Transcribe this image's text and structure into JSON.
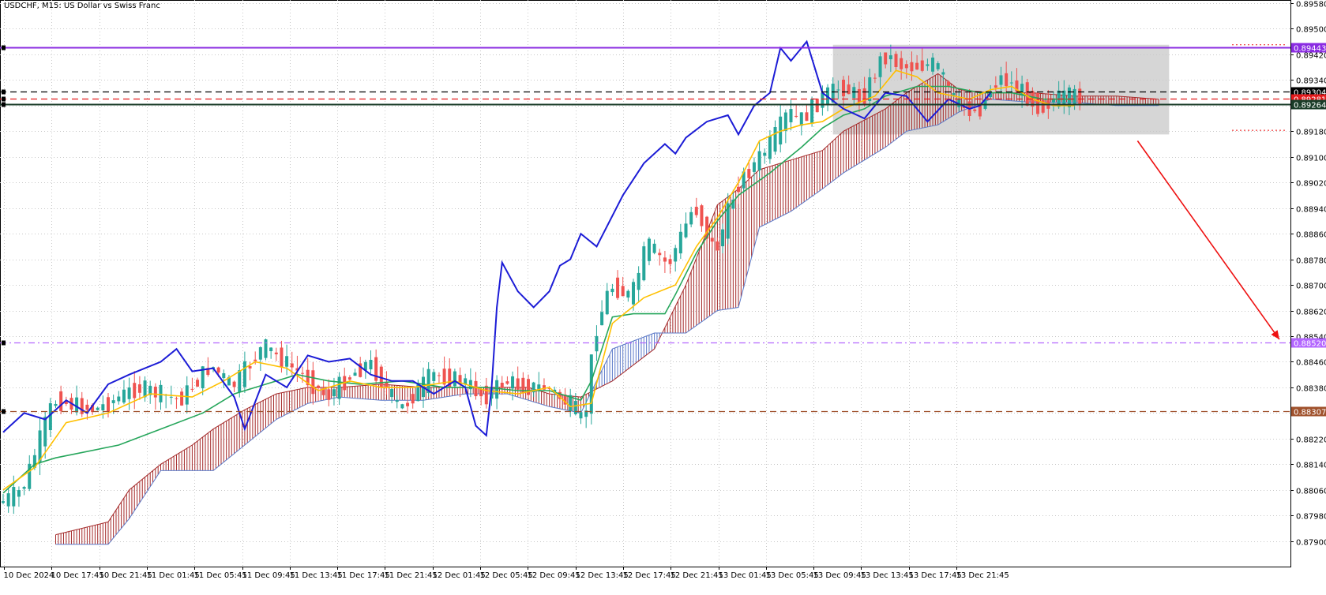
{
  "title": "USDCHF, M15:  US Dollar vs Swiss Franc",
  "colors": {
    "background": "#ffffff",
    "grid": "#c8c8c8",
    "bull": "#26a69a",
    "bear": "#ef5350",
    "tenkan": "#ffc000",
    "kijun": "#26a65b",
    "chikou": "#1c1cd6",
    "cloud_bull": "#5b79c8",
    "cloud_bear": "#a52a2a",
    "resistance": "#8a2be2",
    "tgt": "#b366ff",
    "support": "#a0522d",
    "arrow": "#ee1111",
    "zone": "#c8c8c8"
  },
  "chart_data": {
    "type": "candlestick",
    "symbol": "USDCHF",
    "timeframe": "M15",
    "ylim": [
      0.8785,
      0.8958
    ],
    "y_ticks": [
      "0.89580",
      "0.89500",
      "0.89420",
      "0.89340",
      "0.89260",
      "0.89180",
      "0.89100",
      "0.89020",
      "0.88940",
      "0.88860",
      "0.88780",
      "0.88700",
      "0.88620",
      "0.88540",
      "0.88460",
      "0.88380",
      "0.88300",
      "0.88220",
      "0.88140",
      "0.88060",
      "0.87980",
      "0.87900"
    ],
    "x_ticks": [
      "10 Dec 2024",
      "10 Dec 17:45",
      "10 Dec 21:45",
      "11 Dec 01:45",
      "11 Dec 05:45",
      "11 Dec 09:45",
      "11 Dec 13:45",
      "11 Dec 17:45",
      "11 Dec 21:45",
      "12 Dec 01:45",
      "12 Dec 05:45",
      "12 Dec 09:45",
      "12 Dec 13:45",
      "12 Dec 17:45",
      "12 Dec 21:45",
      "13 Dec 01:45",
      "13 Dec 05:45",
      "13 Dec 09:45",
      "13 Dec 13:45",
      "13 Dec 17:45",
      "13 Dec 21:45"
    ],
    "price_path": [
      [
        0,
        0.8802
      ],
      [
        4,
        0.8806
      ],
      [
        10,
        0.8834
      ],
      [
        18,
        0.8831
      ],
      [
        26,
        0.8838
      ],
      [
        34,
        0.8834
      ],
      [
        40,
        0.8845
      ],
      [
        44,
        0.8838
      ],
      [
        50,
        0.8851
      ],
      [
        58,
        0.8841
      ],
      [
        62,
        0.8835
      ],
      [
        66,
        0.8841
      ],
      [
        70,
        0.8846
      ],
      [
        76,
        0.8831
      ],
      [
        82,
        0.8842
      ],
      [
        88,
        0.884
      ],
      [
        92,
        0.8835
      ],
      [
        96,
        0.884
      ],
      [
        100,
        0.8838
      ],
      [
        104,
        0.8838
      ],
      [
        107,
        0.8834
      ],
      [
        109,
        0.8832
      ],
      [
        111,
        0.8826
      ],
      [
        113,
        0.8855
      ],
      [
        116,
        0.887
      ],
      [
        120,
        0.8866
      ],
      [
        123,
        0.8883
      ],
      [
        127,
        0.8876
      ],
      [
        132,
        0.8895
      ],
      [
        136,
        0.888
      ],
      [
        140,
        0.8901
      ],
      [
        146,
        0.8913
      ],
      [
        150,
        0.8924
      ],
      [
        152,
        0.8921
      ],
      [
        156,
        0.8928
      ],
      [
        160,
        0.8932
      ],
      [
        164,
        0.8928
      ],
      [
        168,
        0.8942
      ],
      [
        172,
        0.8938
      ],
      [
        178,
        0.8939
      ],
      [
        182,
        0.8926
      ],
      [
        186,
        0.8924
      ],
      [
        190,
        0.8935
      ],
      [
        194,
        0.8931
      ],
      [
        198,
        0.8925
      ],
      [
        200,
        0.8928
      ],
      [
        205,
        0.8929
      ]
    ],
    "tenkan_path": [
      [
        0,
        0.8806
      ],
      [
        6,
        0.8813
      ],
      [
        12,
        0.8827
      ],
      [
        20,
        0.883
      ],
      [
        28,
        0.8836
      ],
      [
        36,
        0.8835
      ],
      [
        42,
        0.884
      ],
      [
        48,
        0.8846
      ],
      [
        54,
        0.8844
      ],
      [
        60,
        0.8837
      ],
      [
        66,
        0.884
      ],
      [
        72,
        0.8838
      ],
      [
        78,
        0.8838
      ],
      [
        86,
        0.884
      ],
      [
        92,
        0.8837
      ],
      [
        98,
        0.8836
      ],
      [
        104,
        0.8838
      ],
      [
        108,
        0.8832
      ],
      [
        112,
        0.8833
      ],
      [
        116,
        0.8858
      ],
      [
        122,
        0.8866
      ],
      [
        128,
        0.887
      ],
      [
        132,
        0.8882
      ],
      [
        136,
        0.8891
      ],
      [
        140,
        0.8902
      ],
      [
        144,
        0.8915
      ],
      [
        148,
        0.8918
      ],
      [
        152,
        0.892
      ],
      [
        156,
        0.8921
      ],
      [
        160,
        0.8925
      ],
      [
        166,
        0.8929
      ],
      [
        170,
        0.8937
      ],
      [
        174,
        0.8935
      ],
      [
        178,
        0.893
      ],
      [
        184,
        0.8928
      ],
      [
        188,
        0.8931
      ],
      [
        192,
        0.8932
      ],
      [
        196,
        0.8928
      ],
      [
        200,
        0.8926
      ],
      [
        204,
        0.8926
      ]
    ],
    "kijun_path": [
      [
        0,
        0.8805
      ],
      [
        6,
        0.8814
      ],
      [
        10,
        0.8816
      ],
      [
        22,
        0.882
      ],
      [
        30,
        0.8825
      ],
      [
        38,
        0.883
      ],
      [
        44,
        0.8836
      ],
      [
        50,
        0.8839
      ],
      [
        56,
        0.8842
      ],
      [
        62,
        0.884
      ],
      [
        68,
        0.8839
      ],
      [
        76,
        0.884
      ],
      [
        84,
        0.8838
      ],
      [
        92,
        0.8838
      ],
      [
        98,
        0.8837
      ],
      [
        104,
        0.8837
      ],
      [
        110,
        0.8834
      ],
      [
        112,
        0.884
      ],
      [
        116,
        0.886
      ],
      [
        120,
        0.8861
      ],
      [
        126,
        0.8861
      ],
      [
        128,
        0.8867
      ],
      [
        132,
        0.888
      ],
      [
        136,
        0.889
      ],
      [
        140,
        0.8898
      ],
      [
        146,
        0.8905
      ],
      [
        152,
        0.8913
      ],
      [
        156,
        0.8919
      ],
      [
        160,
        0.8923
      ],
      [
        164,
        0.8925
      ],
      [
        168,
        0.8929
      ],
      [
        174,
        0.8932
      ],
      [
        180,
        0.8932
      ],
      [
        186,
        0.893
      ],
      [
        192,
        0.893
      ],
      [
        198,
        0.8928
      ],
      [
        204,
        0.8928
      ]
    ],
    "chikou_path": [
      [
        0,
        0.8824
      ],
      [
        4,
        0.883
      ],
      [
        8,
        0.8828
      ],
      [
        12,
        0.8834
      ],
      [
        16,
        0.883
      ],
      [
        20,
        0.8839
      ],
      [
        24,
        0.8842
      ],
      [
        30,
        0.8846
      ],
      [
        33,
        0.885
      ],
      [
        36,
        0.8843
      ],
      [
        40,
        0.8844
      ],
      [
        44,
        0.8835
      ],
      [
        46,
        0.8825
      ],
      [
        50,
        0.8842
      ],
      [
        54,
        0.8838
      ],
      [
        58,
        0.8848
      ],
      [
        62,
        0.8846
      ],
      [
        66,
        0.8847
      ],
      [
        70,
        0.8842
      ],
      [
        74,
        0.884
      ],
      [
        78,
        0.884
      ],
      [
        82,
        0.8836
      ],
      [
        86,
        0.884
      ],
      [
        88,
        0.8838
      ],
      [
        90,
        0.8826
      ],
      [
        92,
        0.8823
      ],
      [
        93,
        0.8838
      ],
      [
        94,
        0.8863
      ],
      [
        95,
        0.8877
      ],
      [
        98,
        0.8868
      ],
      [
        101,
        0.8863
      ],
      [
        104,
        0.8868
      ],
      [
        106,
        0.8876
      ],
      [
        108,
        0.8878
      ],
      [
        110,
        0.8886
      ],
      [
        113,
        0.8882
      ],
      [
        118,
        0.8898
      ],
      [
        122,
        0.8908
      ],
      [
        126,
        0.8914
      ],
      [
        128,
        0.8911
      ],
      [
        130,
        0.8916
      ],
      [
        134,
        0.8921
      ],
      [
        138,
        0.8923
      ],
      [
        140,
        0.8917
      ],
      [
        143,
        0.8926
      ],
      [
        146,
        0.893
      ],
      [
        148,
        0.8944
      ],
      [
        150,
        0.894
      ],
      [
        153,
        0.8946
      ],
      [
        156,
        0.893
      ],
      [
        160,
        0.8925
      ],
      [
        164,
        0.8922
      ],
      [
        168,
        0.893
      ],
      [
        172,
        0.8929
      ],
      [
        176,
        0.8921
      ],
      [
        180,
        0.8928
      ],
      [
        184,
        0.8925
      ],
      [
        186,
        0.8926
      ],
      [
        188,
        0.893
      ]
    ],
    "cloud_a": [
      [
        10,
        0.8792
      ],
      [
        20,
        0.8796
      ],
      [
        24,
        0.8806
      ],
      [
        30,
        0.8814
      ],
      [
        36,
        0.882
      ],
      [
        40,
        0.8825
      ],
      [
        46,
        0.8831
      ],
      [
        52,
        0.8836
      ],
      [
        58,
        0.8838
      ],
      [
        64,
        0.8838
      ],
      [
        72,
        0.8839
      ],
      [
        80,
        0.8838
      ],
      [
        88,
        0.8838
      ],
      [
        96,
        0.8838
      ],
      [
        100,
        0.8838
      ],
      [
        104,
        0.8836
      ],
      [
        110,
        0.8835
      ],
      [
        116,
        0.884
      ],
      [
        124,
        0.885
      ],
      [
        130,
        0.887
      ],
      [
        136,
        0.8895
      ],
      [
        140,
        0.89
      ],
      [
        144,
        0.8906
      ],
      [
        150,
        0.8909
      ],
      [
        156,
        0.8912
      ],
      [
        160,
        0.8918
      ],
      [
        168,
        0.8925
      ],
      [
        172,
        0.893
      ],
      [
        178,
        0.8936
      ],
      [
        182,
        0.8931
      ],
      [
        188,
        0.893
      ],
      [
        196,
        0.893
      ],
      [
        204,
        0.8929
      ],
      [
        212,
        0.8929
      ],
      [
        220,
        0.8928
      ]
    ],
    "cloud_b": [
      [
        10,
        0.8789
      ],
      [
        20,
        0.8789
      ],
      [
        24,
        0.8797
      ],
      [
        30,
        0.8812
      ],
      [
        36,
        0.8812
      ],
      [
        40,
        0.8812
      ],
      [
        46,
        0.882
      ],
      [
        52,
        0.8828
      ],
      [
        58,
        0.8833
      ],
      [
        64,
        0.8835
      ],
      [
        72,
        0.8834
      ],
      [
        80,
        0.8834
      ],
      [
        88,
        0.8836
      ],
      [
        96,
        0.8836
      ],
      [
        100,
        0.8834
      ],
      [
        104,
        0.8832
      ],
      [
        110,
        0.883
      ],
      [
        116,
        0.885
      ],
      [
        124,
        0.8855
      ],
      [
        130,
        0.8855
      ],
      [
        136,
        0.8862
      ],
      [
        140,
        0.8863
      ],
      [
        144,
        0.8888
      ],
      [
        150,
        0.8893
      ],
      [
        156,
        0.89
      ],
      [
        160,
        0.8905
      ],
      [
        168,
        0.8913
      ],
      [
        172,
        0.8918
      ],
      [
        178,
        0.892
      ],
      [
        182,
        0.8924
      ],
      [
        188,
        0.8928
      ],
      [
        196,
        0.8927
      ],
      [
        204,
        0.8927
      ],
      [
        212,
        0.8926
      ],
      [
        220,
        0.8926
      ]
    ],
    "levels": [
      {
        "name": "resistance",
        "price": 0.89443,
        "label": "0.89443",
        "style": "solid",
        "color": "#8a2be2"
      },
      {
        "name": "upper",
        "price": 0.89304,
        "label": "0.89304",
        "style": "dash",
        "color": "#000000"
      },
      {
        "name": "mid",
        "price": 0.89281,
        "label": "0.89281",
        "style": "dash",
        "color": "#e41a1c"
      },
      {
        "name": "pivot",
        "price": 0.89264,
        "label": "0.89264",
        "style": "solid",
        "color": "#1a3c28"
      },
      {
        "name": "target",
        "price": 0.8852,
        "label": "0.88520",
        "style": "dashdot",
        "color": "#b366ff"
      },
      {
        "name": "support",
        "price": 0.88307,
        "label": "0.88307",
        "style": "dash",
        "color": "#a0522d"
      }
    ],
    "zone": {
      "x_from": 158,
      "x_to": 222,
      "y_top": 0.8945,
      "y_bottom": 0.8917
    },
    "arrow": {
      "from": [
        216,
        0.8915
      ],
      "to": [
        243,
        0.8853
      ]
    },
    "legend": "none",
    "grid": true
  }
}
